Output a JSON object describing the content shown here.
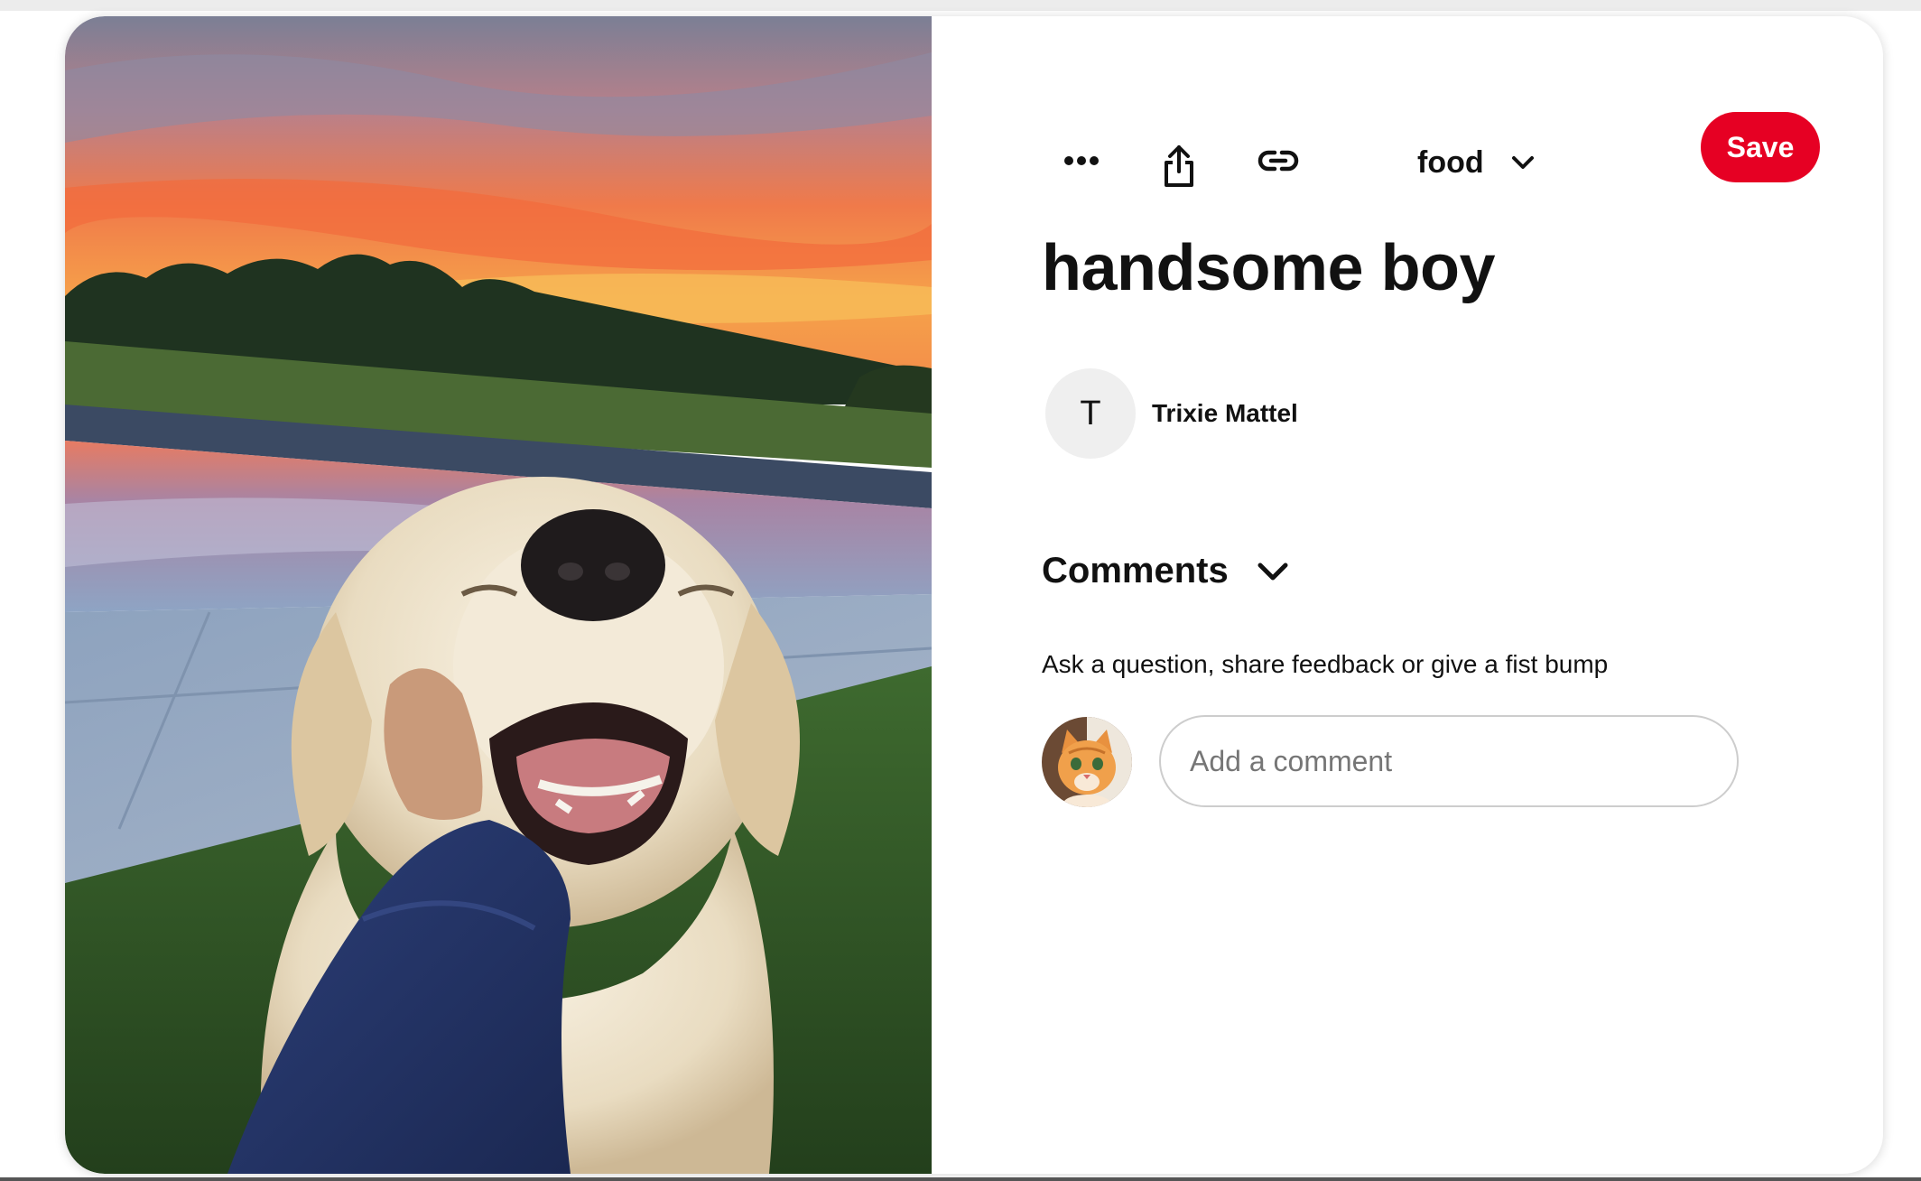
{
  "pin": {
    "title": "handsome boy",
    "image_alt": "Golden retriever smiling in front of a pool at sunset"
  },
  "toolbar": {
    "more_icon": "more-horizontal-icon",
    "share_icon": "share-icon",
    "link_icon": "link-icon",
    "board_name": "food",
    "board_chevron_icon": "chevron-down-icon",
    "save_label": "Save",
    "save_color": "#e60023"
  },
  "creator": {
    "initial": "T",
    "name": "Trixie Mattel"
  },
  "comments": {
    "title": "Comments",
    "chevron_icon": "chevron-down-icon",
    "hint": "Ask a question, share feedback or give a fist bump",
    "input_placeholder": "Add a comment",
    "input_value": ""
  }
}
